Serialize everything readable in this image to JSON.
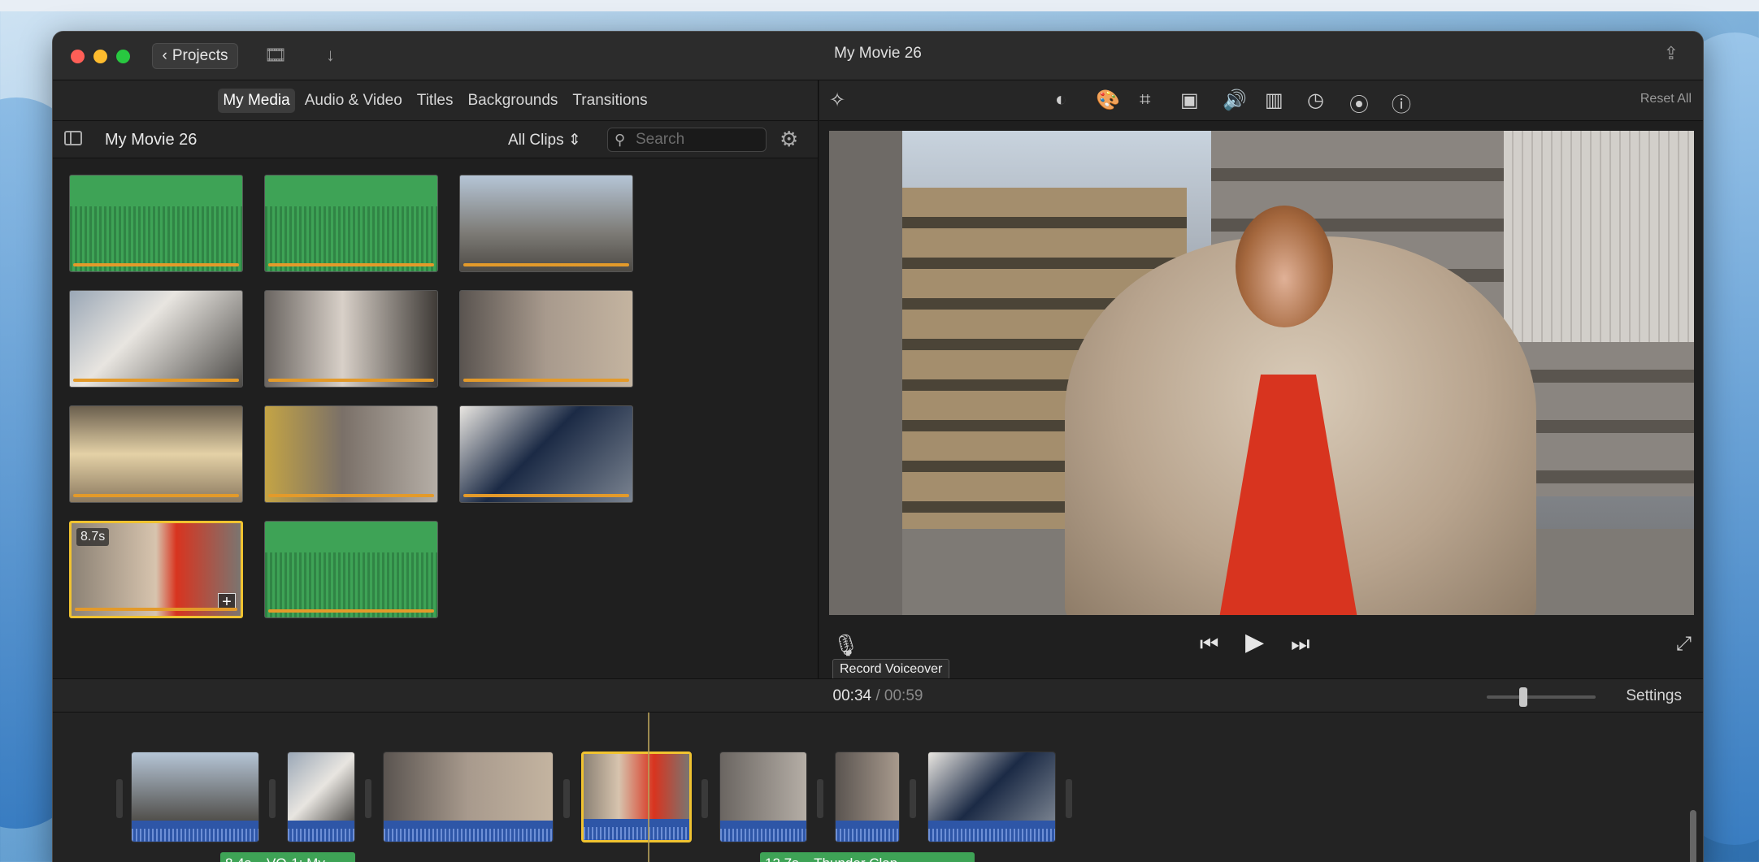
{
  "window": {
    "title": "My Movie 26",
    "projects_label": "Projects"
  },
  "browser": {
    "tabs": [
      {
        "label": "My Media",
        "active": true
      },
      {
        "label": "Audio & Video",
        "active": false
      },
      {
        "label": "Titles",
        "active": false
      },
      {
        "label": "Backgrounds",
        "active": false
      },
      {
        "label": "Transitions",
        "active": false
      }
    ],
    "library_title": "My Movie 26",
    "filter_label": "All Clips",
    "search_placeholder": "Search",
    "selected_clip_duration": "8.7s"
  },
  "viewer": {
    "reset_all_label": "Reset All",
    "record_voiceover_tooltip": "Record Voiceover",
    "icons": [
      "magic-wand-icon",
      "color-balance-icon",
      "color-correction-icon",
      "crop-icon",
      "stabilization-icon",
      "volume-icon",
      "noise-reduction-icon",
      "speed-icon",
      "clip-filter-icon",
      "info-icon"
    ]
  },
  "timeline": {
    "current_time": "00:34",
    "separator": "/",
    "total_time": "00:59",
    "settings_label": "Settings",
    "audio_clips": [
      {
        "label": "8.4s – VO-1: My..."
      },
      {
        "label": "12.7s – Thunder Clap"
      }
    ]
  },
  "colors": {
    "accent_selection": "#f0c330",
    "audio_green": "#3ea356",
    "clip_audio_blue": "#2e56a7",
    "clip_progress_orange": "#e39a2a"
  }
}
